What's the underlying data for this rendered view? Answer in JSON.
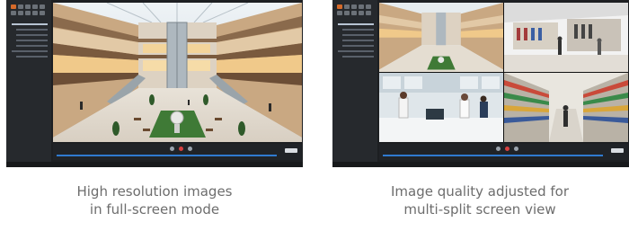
{
  "captions": {
    "left": {
      "line1": "High resolution images",
      "line2": "in full-screen mode"
    },
    "right": {
      "line1": "Image quality adjusted for",
      "line2": "multi-split screen view"
    }
  },
  "screenshots": {
    "left": {
      "layout": "single",
      "scene": "mall-atrium"
    },
    "right": {
      "layout": "4-split",
      "scenes": [
        "mall-atrium",
        "clothing-store",
        "pharmacy-counter",
        "supermarket-aisle"
      ]
    }
  },
  "colors": {
    "accent": "#d66a2a",
    "timeline": "#2f7ad0",
    "record": "#d94040"
  }
}
